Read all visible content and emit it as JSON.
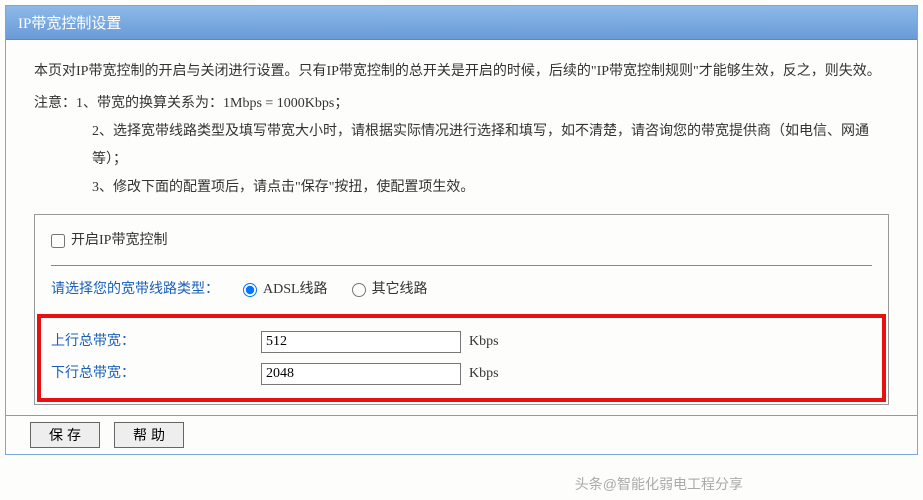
{
  "header": {
    "title": "IP带宽控制设置"
  },
  "intro": {
    "line1": "本页对IP带宽控制的开启与关闭进行设置。只有IP带宽控制的总开关是开启的时候，后续的\"IP带宽控制规则\"才能够生效，反之，则失效。",
    "note_label": "注意：",
    "note1": "1、带宽的换算关系为：1Mbps = 1000Kbps；",
    "note2": "2、选择宽带线路类型及填写带宽大小时，请根据实际情况进行选择和填写，如不清楚，请咨询您的带宽提供商（如电信、网通等）；",
    "note3": "3、修改下面的配置项后，请点击\"保存\"按扭，使配置项生效。"
  },
  "config": {
    "enable_label": "开启IP带宽控制",
    "enable_checked": false,
    "line_type_label": "请选择您的宽带线路类型：",
    "radio_adsl": "ADSL线路",
    "radio_other": "其它线路",
    "selected_line": "adsl",
    "upstream_label": "上行总带宽：",
    "upstream_value": "512",
    "downstream_label": "下行总带宽：",
    "downstream_value": "2048",
    "unit": "Kbps"
  },
  "buttons": {
    "save": "保存",
    "help": "帮助"
  },
  "watermark": "头条@智能化弱电工程分享"
}
